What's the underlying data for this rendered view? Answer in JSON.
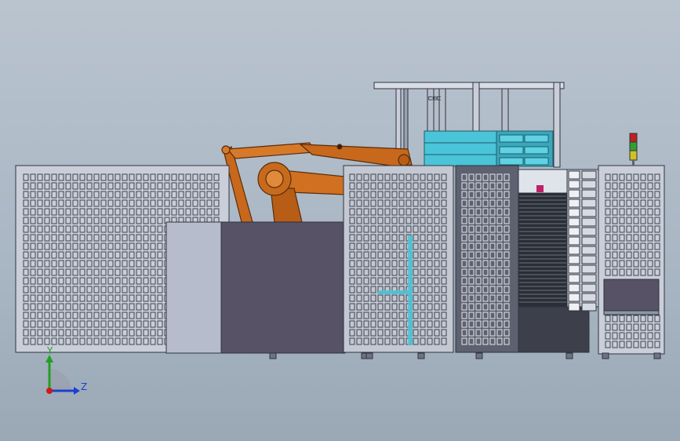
{
  "viewport": {
    "background_top": "#b9c4cf",
    "background_bottom": "#9aa8b6"
  },
  "triad": {
    "y_label": "Y",
    "z_label": "Z",
    "y_color": "#22a022",
    "z_color": "#1c3fd0",
    "origin_color": "#d01818"
  },
  "machine": {
    "robot_color": "#c8681c",
    "guard_panel_color": "#8d96a3",
    "mesh_color": "#3d4450",
    "dark_base_color": "#575266",
    "light_panel_color": "#b6bccc",
    "cyan_color": "#4ac4d8",
    "signal_tower_colors": [
      "#c02020",
      "#30a030",
      "#d0c020"
    ],
    "magenta_marker_color": "#c0206a"
  }
}
